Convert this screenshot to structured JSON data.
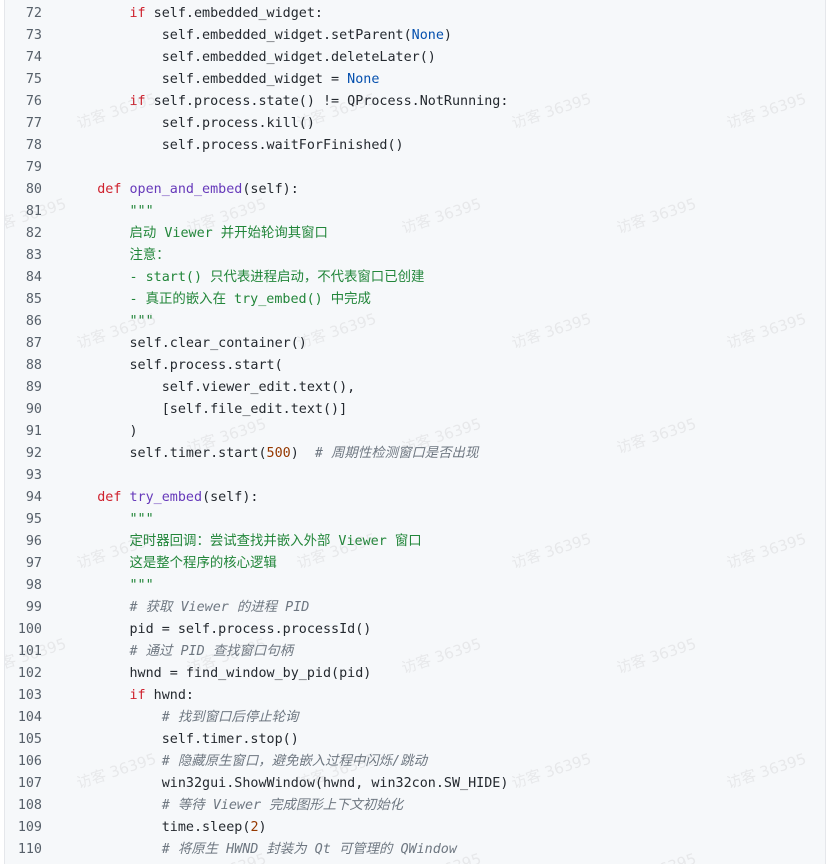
{
  "watermark": "访客 36395",
  "lines": [
    {
      "n": "72",
      "t": [
        [
          "        ",
          ""
        ],
        [
          "if",
          "k"
        ],
        [
          " self.embedded_widget:",
          ""
        ]
      ]
    },
    {
      "n": "73",
      "t": [
        [
          "            self.embedded_widget.setParent(",
          ""
        ],
        [
          "None",
          "n"
        ],
        [
          ")",
          ""
        ]
      ]
    },
    {
      "n": "74",
      "t": [
        [
          "            self.embedded_widget.deleteLater()",
          ""
        ]
      ]
    },
    {
      "n": "75",
      "t": [
        [
          "            self.embedded_widget = ",
          ""
        ],
        [
          "None",
          "n"
        ]
      ]
    },
    {
      "n": "76",
      "t": [
        [
          "        ",
          ""
        ],
        [
          "if",
          "k"
        ],
        [
          " self.process.state() != QProcess.NotRunning:",
          ""
        ]
      ]
    },
    {
      "n": "77",
      "t": [
        [
          "            self.process.kill()",
          ""
        ]
      ]
    },
    {
      "n": "78",
      "t": [
        [
          "            self.process.waitForFinished()",
          ""
        ]
      ]
    },
    {
      "n": "79",
      "t": []
    },
    {
      "n": "80",
      "t": [
        [
          "    ",
          ""
        ],
        [
          "def",
          "k"
        ],
        [
          " ",
          ""
        ],
        [
          "open_and_embed",
          "f"
        ],
        [
          "(self):",
          ""
        ]
      ]
    },
    {
      "n": "81",
      "t": [
        [
          "        ",
          ""
        ],
        [
          "\"\"\"",
          "str"
        ]
      ]
    },
    {
      "n": "82",
      "t": [
        [
          "        ",
          ""
        ],
        [
          "启动 Viewer 并开始轮询其窗口",
          "str"
        ]
      ]
    },
    {
      "n": "83",
      "t": [
        [
          "        ",
          ""
        ],
        [
          "注意：",
          "str"
        ]
      ]
    },
    {
      "n": "84",
      "t": [
        [
          "        ",
          ""
        ],
        [
          "- start() 只代表进程启动，不代表窗口已创建",
          "str"
        ]
      ]
    },
    {
      "n": "85",
      "t": [
        [
          "        ",
          ""
        ],
        [
          "- 真正的嵌入在 try_embed() 中完成",
          "str"
        ]
      ]
    },
    {
      "n": "86",
      "t": [
        [
          "        ",
          ""
        ],
        [
          "\"\"\"",
          "str"
        ]
      ]
    },
    {
      "n": "87",
      "t": [
        [
          "        self.clear_container()",
          ""
        ]
      ]
    },
    {
      "n": "88",
      "t": [
        [
          "        self.process.start(",
          ""
        ]
      ]
    },
    {
      "n": "89",
      "t": [
        [
          "            self.viewer_edit.text(),",
          ""
        ]
      ]
    },
    {
      "n": "90",
      "t": [
        [
          "            [self.file_edit.text()]",
          ""
        ]
      ]
    },
    {
      "n": "91",
      "t": [
        [
          "        )",
          ""
        ]
      ]
    },
    {
      "n": "92",
      "t": [
        [
          "        self.timer.start(",
          ""
        ],
        [
          "500",
          "num"
        ],
        [
          ")  ",
          ""
        ],
        [
          "# 周期性检测窗口是否出现",
          "cm"
        ]
      ]
    },
    {
      "n": "93",
      "t": []
    },
    {
      "n": "94",
      "t": [
        [
          "    ",
          ""
        ],
        [
          "def",
          "k"
        ],
        [
          " ",
          ""
        ],
        [
          "try_embed",
          "f"
        ],
        [
          "(self):",
          ""
        ]
      ]
    },
    {
      "n": "95",
      "t": [
        [
          "        ",
          ""
        ],
        [
          "\"\"\"",
          "str"
        ]
      ]
    },
    {
      "n": "96",
      "t": [
        [
          "        ",
          ""
        ],
        [
          "定时器回调：尝试查找并嵌入外部 Viewer 窗口",
          "str"
        ]
      ]
    },
    {
      "n": "97",
      "t": [
        [
          "        ",
          ""
        ],
        [
          "这是整个程序的核心逻辑",
          "str"
        ]
      ]
    },
    {
      "n": "98",
      "t": [
        [
          "        ",
          ""
        ],
        [
          "\"\"\"",
          "str"
        ]
      ]
    },
    {
      "n": "99",
      "t": [
        [
          "        ",
          ""
        ],
        [
          "# 获取 Viewer 的进程 PID",
          "cm"
        ]
      ]
    },
    {
      "n": "100",
      "t": [
        [
          "        pid = self.process.processId()",
          ""
        ]
      ]
    },
    {
      "n": "101",
      "t": [
        [
          "        ",
          ""
        ],
        [
          "# 通过 PID 查找窗口句柄",
          "cm"
        ]
      ]
    },
    {
      "n": "102",
      "t": [
        [
          "        hwnd = find_window_by_pid(pid)",
          ""
        ]
      ]
    },
    {
      "n": "103",
      "t": [
        [
          "        ",
          ""
        ],
        [
          "if",
          "k"
        ],
        [
          " hwnd:",
          ""
        ]
      ]
    },
    {
      "n": "104",
      "t": [
        [
          "            ",
          ""
        ],
        [
          "# 找到窗口后停止轮询",
          "cm"
        ]
      ]
    },
    {
      "n": "105",
      "t": [
        [
          "            self.timer.stop()",
          ""
        ]
      ]
    },
    {
      "n": "106",
      "t": [
        [
          "            ",
          ""
        ],
        [
          "# 隐藏原生窗口，避免嵌入过程中闪烁/跳动",
          "cm"
        ]
      ]
    },
    {
      "n": "107",
      "t": [
        [
          "            win32gui.ShowWindow(hwnd, win32con.SW_HIDE)",
          ""
        ]
      ]
    },
    {
      "n": "108",
      "t": [
        [
          "            ",
          ""
        ],
        [
          "# 等待 Viewer 完成图形上下文初始化",
          "cm"
        ]
      ]
    },
    {
      "n": "109",
      "t": [
        [
          "            time.sleep(",
          ""
        ],
        [
          "2",
          "num"
        ],
        [
          ")",
          ""
        ]
      ]
    },
    {
      "n": "110",
      "t": [
        [
          "            ",
          ""
        ],
        [
          "# 将原生 HWND 封装为 Qt 可管理的 QWindow",
          "cm"
        ]
      ]
    }
  ]
}
